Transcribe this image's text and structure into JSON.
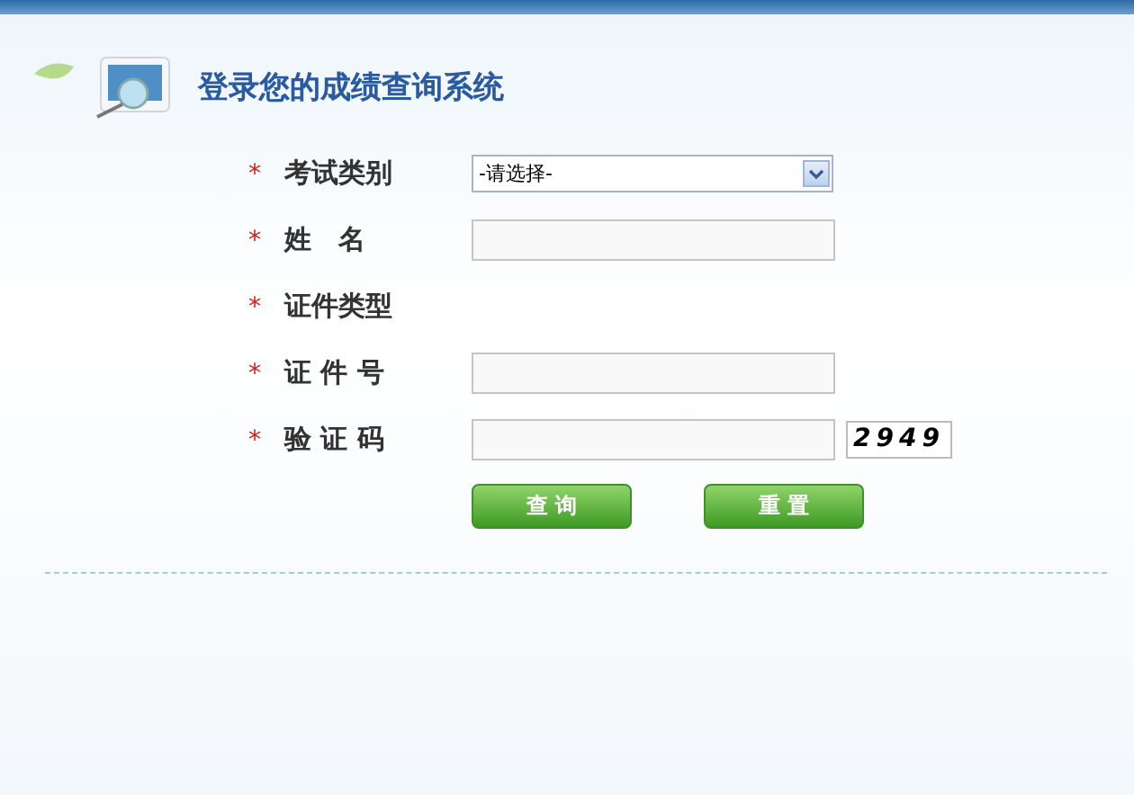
{
  "header": {
    "title": "登录您的成绩查询系统"
  },
  "fields": [
    {
      "label": "考试类别",
      "required_mark": "*",
      "kind": "select",
      "value": "-请选择-"
    },
    {
      "label": "姓　名",
      "required_mark": "*",
      "kind": "text"
    },
    {
      "label": "证件类型",
      "required_mark": "*",
      "kind": "none"
    },
    {
      "label": "证 件 号",
      "required_mark": "*",
      "kind": "text"
    },
    {
      "label": "验 证 码",
      "required_mark": "*",
      "kind": "captcha",
      "captcha": "2949"
    }
  ],
  "buttons": [
    "查 询",
    "重 置"
  ]
}
